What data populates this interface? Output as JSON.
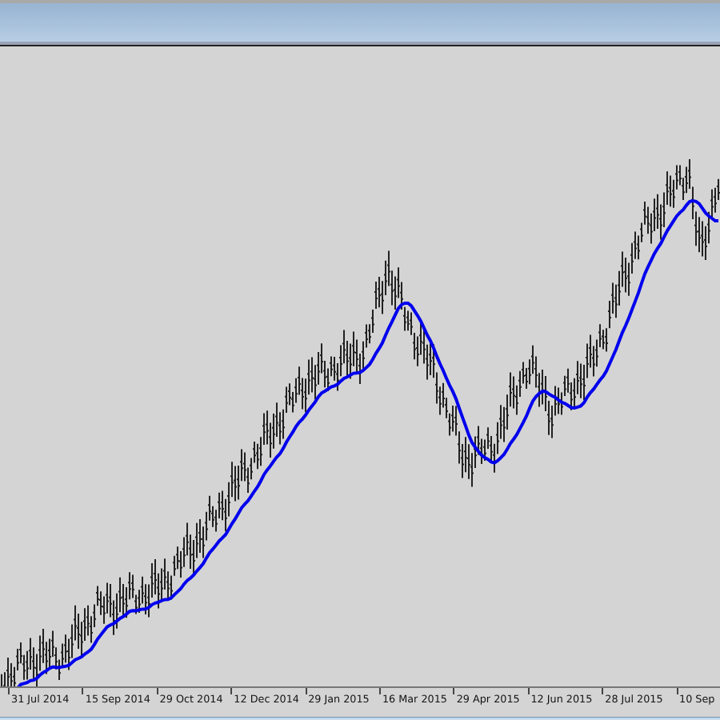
{
  "chart": {
    "x_axis_labels": [
      "31 Jul 2014",
      "15 Sep 2014",
      "29 Oct 2014",
      "12 Dec 2014",
      "29 Jan 2015",
      "16 Mar 2015",
      "29 Apr 2015",
      "12 Jun 2015",
      "28 Jul 2015",
      "10 Sep"
    ]
  }
}
